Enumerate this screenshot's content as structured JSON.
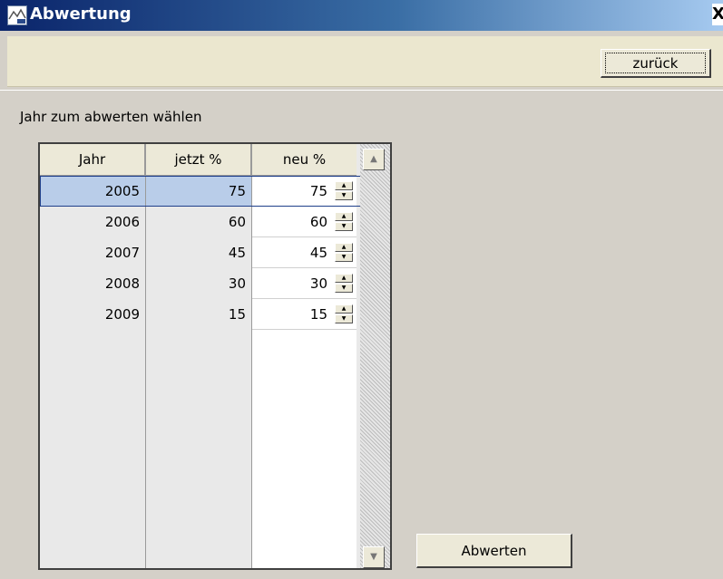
{
  "window": {
    "title": "Abwertung",
    "close_label": "X"
  },
  "toolbar": {
    "back_label": "zurück"
  },
  "prompt": "Jahr zum abwerten wählen",
  "table": {
    "columns": [
      "Jahr",
      "jetzt %",
      "neu %"
    ],
    "rows": [
      {
        "jahr": "2005",
        "jetzt": "75",
        "neu": "75"
      },
      {
        "jahr": "2006",
        "jetzt": "60",
        "neu": "60"
      },
      {
        "jahr": "2007",
        "jetzt": "45",
        "neu": "45"
      },
      {
        "jahr": "2008",
        "jetzt": "30",
        "neu": "30"
      },
      {
        "jahr": "2009",
        "jetzt": "15",
        "neu": "15"
      }
    ],
    "selected_row": 0
  },
  "actions": {
    "devalue_label": "Abwerten"
  },
  "icons": {
    "app": "app-window-icon",
    "spin_up": "spin-up-icon",
    "spin_down": "spin-down-icon",
    "scroll_up": "scroll-up-arrow-icon",
    "scroll_down": "scroll-down-arrow-icon"
  },
  "colors": {
    "titlebar_start": "#0a246a",
    "titlebar_end": "#a6caf0",
    "selection": "#b9cde9",
    "window_bg": "#d4d0c8"
  }
}
